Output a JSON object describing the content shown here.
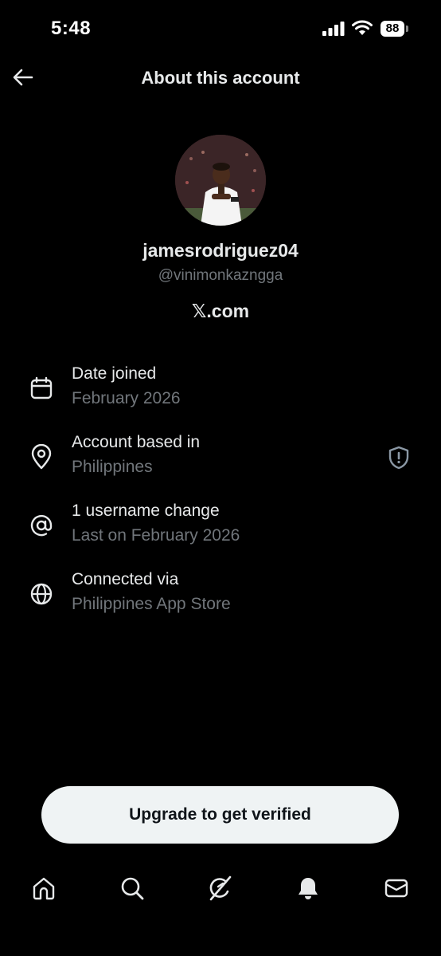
{
  "status_bar": {
    "time": "5:48",
    "battery": "88"
  },
  "header": {
    "title": "About this account",
    "back_icon": "arrow-left-icon"
  },
  "profile": {
    "display_name": "jamesrodriguez04",
    "handle": "@vinimonkazngga",
    "platform": "𝕏.com"
  },
  "info": [
    {
      "icon": "calendar-icon",
      "title": "Date joined",
      "subtitle": "February 2026"
    },
    {
      "icon": "location-pin-icon",
      "title": "Account based in",
      "subtitle": "Philippines",
      "trailing_icon": "shield-alert-icon"
    },
    {
      "icon": "at-sign-icon",
      "title": "1 username change",
      "subtitle": "Last on February 2026"
    },
    {
      "icon": "globe-icon",
      "title": "Connected via",
      "subtitle": "Philippines App Store"
    }
  ],
  "upgrade_button": {
    "label": "Upgrade to get verified"
  },
  "bottom_nav": [
    {
      "icon": "home-icon"
    },
    {
      "icon": "search-icon"
    },
    {
      "icon": "grok-icon"
    },
    {
      "icon": "bell-icon",
      "active": true
    },
    {
      "icon": "mail-icon"
    }
  ],
  "colors": {
    "background": "#000000",
    "primary_text": "#e7e9ea",
    "secondary_text": "#71767b",
    "button_bg": "#eff3f4"
  }
}
